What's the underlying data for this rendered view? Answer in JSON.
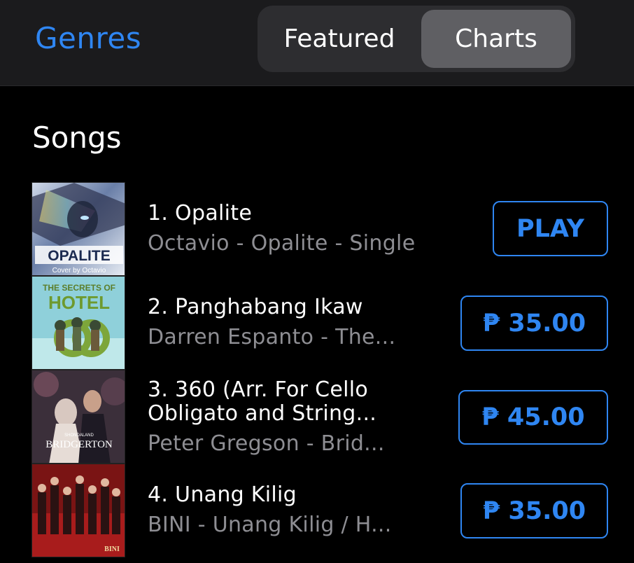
{
  "header": {
    "genres_label": "Genres",
    "tabs": [
      {
        "label": "Featured",
        "selected": false
      },
      {
        "label": "Charts",
        "selected": true
      }
    ]
  },
  "section_title": "Songs",
  "songs": [
    {
      "title": "1. Opalite",
      "subtitle": "Octavio - Opalite - Single",
      "button": "PLAY",
      "art": {
        "text": "OPALITE",
        "subtext": "Cover by Octavio"
      }
    },
    {
      "title": "2. Panghabang Ikaw",
      "subtitle": "Darren Espanto - The...",
      "button": "₱ 35.00",
      "art": {
        "text": "THE SECRETS OF",
        "subtext": "HOTEL"
      }
    },
    {
      "title_line1": "3. 360 (Arr. For Cello",
      "title_line2": "Obligato and String...",
      "subtitle": "Peter Gregson - Brid...",
      "button": "₱ 45.00",
      "art": {
        "text": "BRIDGERTON",
        "subtext": "SHONDALAND"
      }
    },
    {
      "title": "4. Unang Kilig",
      "subtitle": "BINI - Unang Kilig / H...",
      "button": "₱ 35.00",
      "art": {
        "text": "BINI"
      }
    }
  ],
  "colors": {
    "accent": "#2f86f2",
    "background": "#000000",
    "header_bg": "#1b1b1d",
    "subtitle": "#8e8e93"
  }
}
